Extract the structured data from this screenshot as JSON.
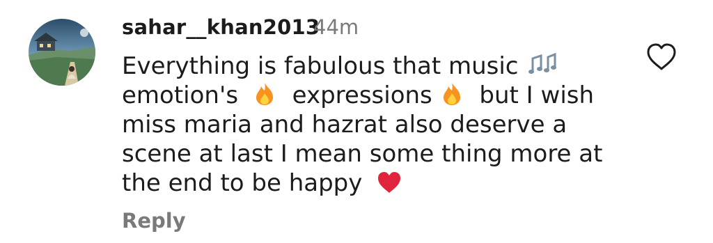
{
  "comment": {
    "username": "sahar__khan2013",
    "time": "44m",
    "lines": [
      "Everything is fabulous that music",
      "emotion's",
      "expressions",
      "but I wish",
      "miss maria and hazrat also deserve a",
      "scene at last I mean some thing more at",
      "the end to be happy"
    ],
    "emojis": {
      "music": "🎶",
      "fire": "🔥",
      "heart": "❤️"
    },
    "reply_label": "Reply"
  },
  "colors": {
    "text": "#1c1c1c",
    "muted": "#7a7a7a",
    "heart_emoji": "#e0243c",
    "fire_outer": "#f7931e",
    "fire_inner": "#ffd23f"
  },
  "icons": {
    "like": "heart-outline-icon",
    "avatar": "user-avatar-image"
  }
}
